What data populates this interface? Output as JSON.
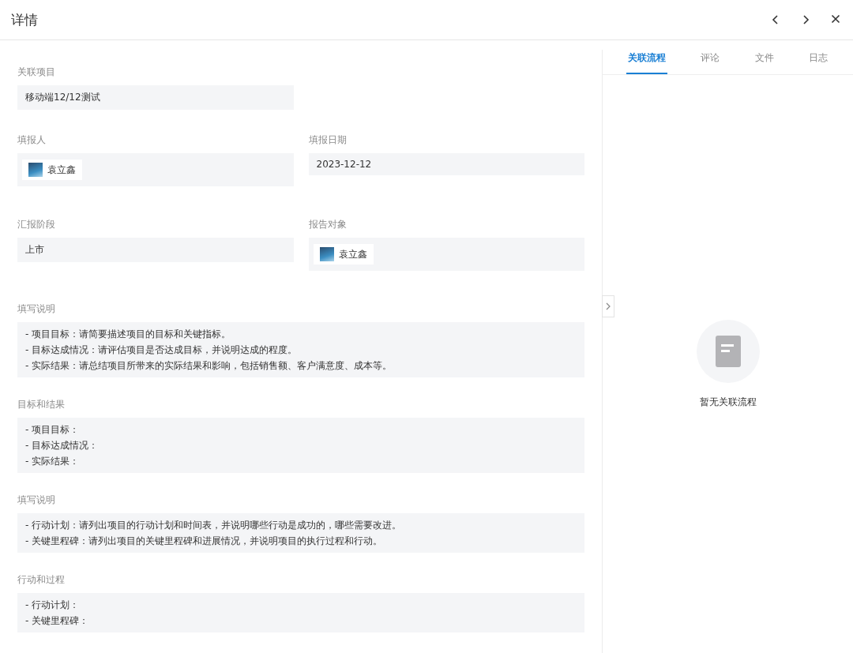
{
  "title": "详情",
  "rows": [
    [
      {
        "label": "关联项目",
        "kind": "text",
        "value": "移动端12/12测试"
      }
    ],
    [
      {
        "label": "填报人",
        "kind": "person",
        "value": "袁立鑫"
      },
      {
        "label": "填报日期",
        "kind": "text",
        "value": "2023-12-12"
      }
    ],
    [
      {
        "label": "汇报阶段",
        "kind": "text",
        "value": "上市"
      },
      {
        "label": "报告对象",
        "kind": "person",
        "value": "袁立鑫"
      }
    ],
    [
      {
        "label": "填写说明",
        "kind": "multiline",
        "lines": [
          "- 项目目标：请简要描述项目的目标和关键指标。",
          "- 目标达成情况：请评估项目是否达成目标，并说明达成的程度。",
          "- 实际结果：请总结项目所带来的实际结果和影响，包括销售额、客户满意度、成本等。"
        ]
      }
    ],
    [
      {
        "label": "目标和结果",
        "kind": "multiline",
        "lines": [
          "- 项目目标：",
          "- 目标达成情况：",
          "- 实际结果："
        ]
      }
    ],
    [
      {
        "label": "填写说明",
        "kind": "multiline",
        "lines": [
          "- 行动计划：请列出项目的行动计划和时间表，并说明哪些行动是成功的，哪些需要改进。",
          "- 关键里程碑：请列出项目的关键里程碑和进展情况，并说明项目的执行过程和行动。"
        ]
      }
    ],
    [
      {
        "label": "行动和过程",
        "kind": "multiline",
        "lines": [
          "- 行动计划：",
          "- 关键里程碑："
        ]
      }
    ]
  ],
  "tabs": [
    {
      "label": "关联流程",
      "selected": true
    },
    {
      "label": "评论",
      "selected": false
    },
    {
      "label": "文件",
      "selected": false
    },
    {
      "label": "日志",
      "selected": false
    }
  ],
  "empty_text": "暂无关联流程"
}
